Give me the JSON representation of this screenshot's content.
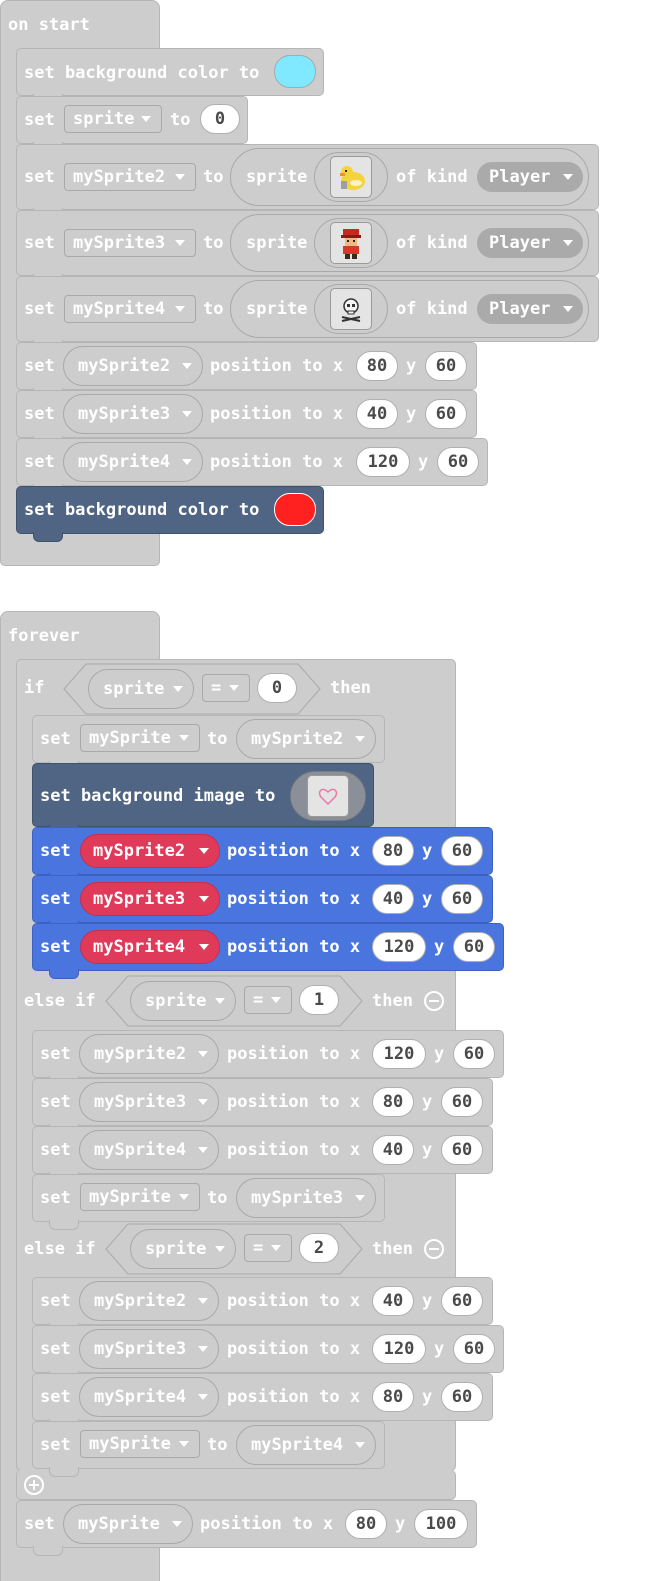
{
  "on_start": {
    "hat_label": "on start",
    "set_bg1": {
      "label": "set background color to",
      "color": "#80e8ff"
    },
    "set_sprite": {
      "set": "set",
      "var": "sprite",
      "to": "to",
      "value": "0"
    },
    "create_sprites": [
      {
        "set": "set",
        "var": "mySprite2",
        "to": "to",
        "sprite": "sprite",
        "image": "duck-sprite-image",
        "of_kind": "of kind",
        "kind": "Player"
      },
      {
        "set": "set",
        "var": "mySprite3",
        "to": "to",
        "sprite": "sprite",
        "image": "red-cap-hero-sprite-image",
        "of_kind": "of kind",
        "kind": "Player"
      },
      {
        "set": "set",
        "var": "mySprite4",
        "to": "to",
        "sprite": "sprite",
        "image": "skull-sprite-image",
        "of_kind": "of kind",
        "kind": "Player"
      }
    ],
    "positions": [
      {
        "set": "set",
        "var": "mySprite2",
        "position": "position to x",
        "x": "80",
        "y_label": "y",
        "y": "60"
      },
      {
        "set": "set",
        "var": "mySprite3",
        "position": "position to x",
        "x": "40",
        "y_label": "y",
        "y": "60"
      },
      {
        "set": "set",
        "var": "mySprite4",
        "position": "position to x",
        "x": "120",
        "y_label": "y",
        "y": "60"
      }
    ],
    "set_bg2": {
      "label": "set background color to",
      "color": "#ff2020"
    }
  },
  "forever": {
    "hat_label": "forever",
    "if_block": {
      "if": "if",
      "var": "sprite",
      "op": "=",
      "value": "0",
      "then": "then",
      "set_mysprite": {
        "set": "set",
        "var": "mySprite",
        "to": "to",
        "value": "mySprite2"
      },
      "set_bg_image": {
        "label": "set background image to",
        "image": "heart-image"
      },
      "positions": [
        {
          "set": "set",
          "var": "mySprite2",
          "position": "position to x",
          "x": "80",
          "y_label": "y",
          "y": "60"
        },
        {
          "set": "set",
          "var": "mySprite3",
          "position": "position to x",
          "x": "40",
          "y_label": "y",
          "y": "60"
        },
        {
          "set": "set",
          "var": "mySprite4",
          "position": "position to x",
          "x": "120",
          "y_label": "y",
          "y": "60"
        }
      ]
    },
    "else_if_1": {
      "label": "else if",
      "var": "sprite",
      "op": "=",
      "value": "1",
      "then": "then",
      "positions": [
        {
          "set": "set",
          "var": "mySprite2",
          "position": "position to x",
          "x": "120",
          "y_label": "y",
          "y": "60"
        },
        {
          "set": "set",
          "var": "mySprite3",
          "position": "position to x",
          "x": "80",
          "y_label": "y",
          "y": "60"
        },
        {
          "set": "set",
          "var": "mySprite4",
          "position": "position to x",
          "x": "40",
          "y_label": "y",
          "y": "60"
        }
      ],
      "set_mysprite": {
        "set": "set",
        "var": "mySprite",
        "to": "to",
        "value": "mySprite3"
      }
    },
    "else_if_2": {
      "label": "else if",
      "var": "sprite",
      "op": "=",
      "value": "2",
      "then": "then",
      "positions": [
        {
          "set": "set",
          "var": "mySprite2",
          "position": "position to x",
          "x": "40",
          "y_label": "y",
          "y": "60"
        },
        {
          "set": "set",
          "var": "mySprite3",
          "position": "position to x",
          "x": "120",
          "y_label": "y",
          "y": "60"
        },
        {
          "set": "set",
          "var": "mySprite4",
          "position": "position to x",
          "x": "80",
          "y_label": "y",
          "y": "60"
        }
      ],
      "set_mysprite": {
        "set": "set",
        "var": "mySprite",
        "to": "to",
        "value": "mySprite4"
      }
    },
    "final_position": {
      "set": "set",
      "var": "mySprite",
      "position": "position to x",
      "x": "80",
      "y_label": "y",
      "y": "100"
    }
  }
}
